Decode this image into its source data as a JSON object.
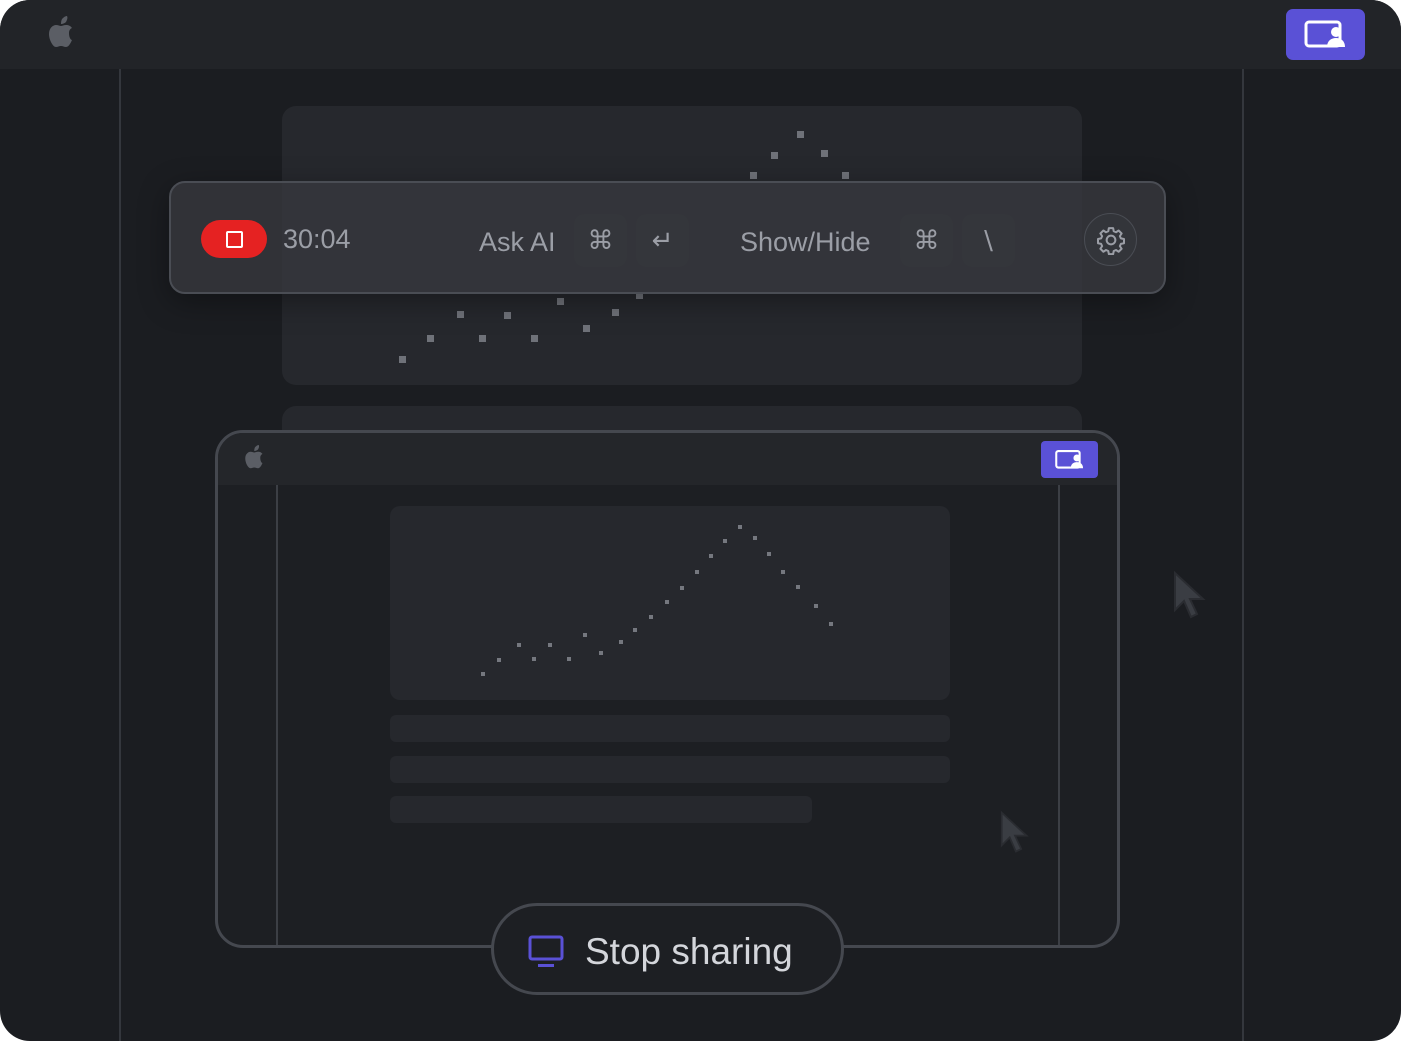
{
  "menubar": {
    "logo_icon": "apple-logo",
    "share_icon": "screen-share-icon",
    "accent": "#5a51d6"
  },
  "toolbar": {
    "timer": "30:04",
    "ask_ai_label": "Ask AI",
    "ask_ai_keys": [
      "⌘",
      "↵"
    ],
    "show_hide_label": "Show/Hide",
    "show_hide_keys": [
      "⌘",
      "\\"
    ],
    "record_color": "#e52222",
    "settings_icon": "gear-icon"
  },
  "preview": {
    "logo_icon": "apple-logo",
    "share_icon": "screen-share-icon"
  },
  "stop_sharing": {
    "label": "Stop sharing",
    "icon": "monitor-icon"
  }
}
